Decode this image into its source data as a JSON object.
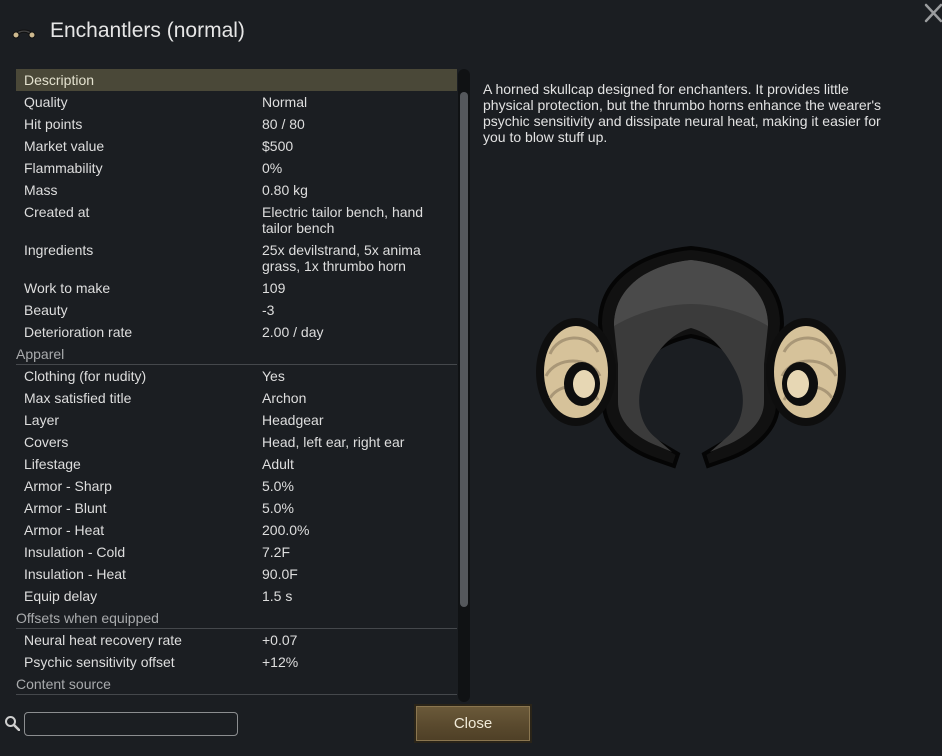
{
  "window": {
    "title": "Enchantlers (normal)",
    "title_icon": "enchantlers-item-icon",
    "close_icon": "close-x-icon"
  },
  "stats": {
    "description_header": "Description",
    "general": [
      {
        "label": "Quality",
        "value": "Normal"
      },
      {
        "label": "Hit points",
        "value": "80 / 80"
      },
      {
        "label": "Market value",
        "value": "$500"
      },
      {
        "label": "Flammability",
        "value": "0%"
      },
      {
        "label": "Mass",
        "value": "0.80 kg"
      },
      {
        "label": "Created at",
        "value": "Electric tailor bench, hand tailor bench"
      },
      {
        "label": "Ingredients",
        "value": "25x devilstrand, 5x anima grass, 1x thrumbo horn"
      },
      {
        "label": "Work to make",
        "value": "109"
      },
      {
        "label": "Beauty",
        "value": "-3"
      },
      {
        "label": "Deterioration rate",
        "value": "2.00 / day"
      }
    ],
    "apparel_header": "Apparel",
    "apparel": [
      {
        "label": "Clothing (for nudity)",
        "value": "Yes"
      },
      {
        "label": "Max satisfied title",
        "value": "Archon"
      },
      {
        "label": "Layer",
        "value": "Headgear"
      },
      {
        "label": "Covers",
        "value": "Head, left ear, right ear"
      },
      {
        "label": "Lifestage",
        "value": "Adult"
      },
      {
        "label": "Armor - Sharp",
        "value": "5.0%"
      },
      {
        "label": "Armor - Blunt",
        "value": "5.0%"
      },
      {
        "label": "Armor - Heat",
        "value": "200.0%"
      },
      {
        "label": "Insulation - Cold",
        "value": "7.2F"
      },
      {
        "label": "Insulation - Heat",
        "value": "90.0F"
      },
      {
        "label": "Equip delay",
        "value": "1.5 s"
      }
    ],
    "offsets_header": "Offsets when equipped",
    "offsets": [
      {
        "label": "Neural heat recovery rate",
        "value": "+0.07"
      },
      {
        "label": "Psychic sensitivity offset",
        "value": "+12%"
      }
    ],
    "content_source_header": "Content source"
  },
  "description": {
    "text": "A horned skullcap designed for enchanters. It provides little physical protection, but the thrumbo horns enhance the wearer's psychic sensitivity and dissipate neural heat, making it easier for you to blow stuff up."
  },
  "item_art": "enchantlers-horned-skullcap-icon",
  "footer": {
    "search_icon": "search-icon",
    "search_value": "",
    "close_label": "Close"
  },
  "colors": {
    "background": "#1b1e22",
    "highlight_row": "#4a4838",
    "close_button": "#5a4a2e",
    "horn": "#d6c29a",
    "cap": "#3a3a3a"
  }
}
